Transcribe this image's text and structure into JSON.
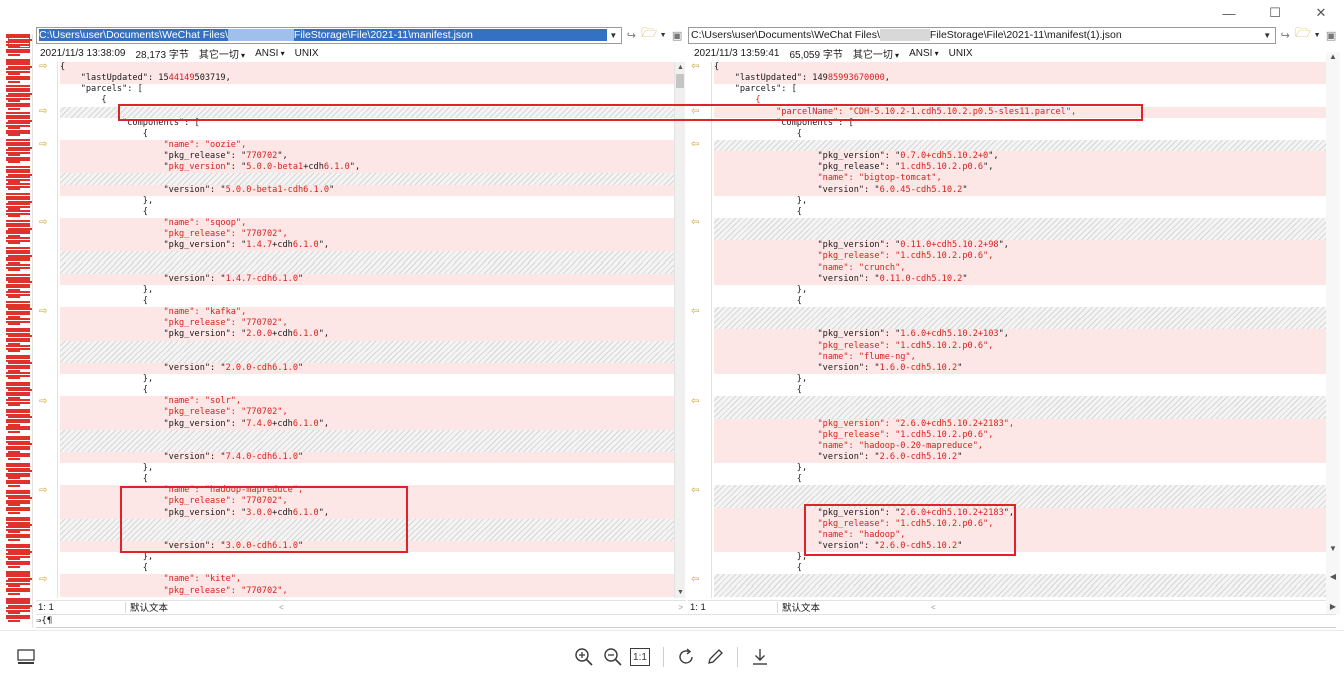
{
  "window": {
    "minimize": "—",
    "maximize": "☐",
    "close": "✕"
  },
  "left": {
    "path_prefix": "C:\\Users\\user\\Documents\\WeChat Files\\",
    "path_suffix": "FileStorage\\File\\2021-11\\manifest.json",
    "timestamp": "2021/11/3 13:38:09",
    "size": "28,173 字节",
    "other": "其它一切",
    "encoding": "ANSI",
    "lineend": "UNIX",
    "status_pos": "1: 1",
    "status_enc": "默认文本"
  },
  "right": {
    "path_prefix": "C:\\Users\\user\\Documents\\WeChat Files\\",
    "path_suffix": "FileStorage\\File\\2021-11\\manifest(1).json",
    "timestamp": "2021/11/3 13:59:41",
    "size": "65,059 字节",
    "other": "其它一切",
    "encoding": "ANSI",
    "lineend": "UNIX",
    "status_pos": "1: 1",
    "status_enc": "默认文本"
  },
  "left_lines": [
    {
      "t": "d",
      "parts": [
        [
          "k",
          "{"
        ]
      ]
    },
    {
      "t": "d",
      "parts": [
        [
          "k",
          "    \"lastUpdated\": 15"
        ],
        [
          "r",
          "44149"
        ],
        [
          "k",
          "503719,"
        ]
      ]
    },
    {
      "t": "n",
      "parts": [
        [
          "k",
          "    \"parcels\": ["
        ]
      ]
    },
    {
      "t": "n",
      "parts": [
        [
          "k",
          "        {"
        ]
      ]
    },
    {
      "t": "h",
      "parts": []
    },
    {
      "t": "n",
      "parts": [
        [
          "k",
          "            \"components\": ["
        ]
      ]
    },
    {
      "t": "n",
      "parts": [
        [
          "k",
          "                {"
        ]
      ]
    },
    {
      "t": "d",
      "parts": [
        [
          "r",
          "                    \"name\": \"oozie\","
        ]
      ]
    },
    {
      "t": "d",
      "parts": [
        [
          "k",
          "                    \"pkg_release\": \""
        ],
        [
          "r",
          "770702"
        ],
        [
          "k",
          "\","
        ]
      ]
    },
    {
      "t": "d",
      "parts": [
        [
          "k",
          "                    \""
        ],
        [
          "r",
          "pkg_version"
        ],
        [
          "k",
          "\": \""
        ],
        [
          "r",
          "5.0.0-beta1"
        ],
        [
          "k",
          "+cdh"
        ],
        [
          "r",
          "6.1.0"
        ],
        [
          "k",
          "\","
        ]
      ]
    },
    {
      "t": "h",
      "parts": []
    },
    {
      "t": "d",
      "parts": [
        [
          "k",
          "                    \"version\": \""
        ],
        [
          "r",
          "5.0.0-beta1-cdh6.1.0"
        ],
        [
          "k",
          "\""
        ]
      ]
    },
    {
      "t": "n",
      "parts": [
        [
          "k",
          "                },"
        ]
      ]
    },
    {
      "t": "n",
      "parts": [
        [
          "k",
          "                {"
        ]
      ]
    },
    {
      "t": "d",
      "parts": [
        [
          "r",
          "                    \"name\": \"sqoop\","
        ]
      ]
    },
    {
      "t": "d",
      "parts": [
        [
          "r",
          "                    \"pkg_release\": \"770702\","
        ]
      ]
    },
    {
      "t": "d",
      "parts": [
        [
          "k",
          "                    \"pkg_version\": \""
        ],
        [
          "r",
          "1.4.7"
        ],
        [
          "k",
          "+cdh"
        ],
        [
          "r",
          "6.1.0"
        ],
        [
          "k",
          "\","
        ]
      ]
    },
    {
      "t": "h",
      "parts": []
    },
    {
      "t": "h",
      "parts": []
    },
    {
      "t": "d",
      "parts": [
        [
          "k",
          "                    \"version\": \""
        ],
        [
          "r",
          "1.4.7-cdh6.1.0"
        ],
        [
          "k",
          "\""
        ]
      ]
    },
    {
      "t": "n",
      "parts": [
        [
          "k",
          "                },"
        ]
      ]
    },
    {
      "t": "n",
      "parts": [
        [
          "k",
          "                {"
        ]
      ]
    },
    {
      "t": "d",
      "parts": [
        [
          "r",
          "                    \"name\": \"kafka\","
        ]
      ]
    },
    {
      "t": "d",
      "parts": [
        [
          "r",
          "                    \"pkg_release\": \"770702\","
        ]
      ]
    },
    {
      "t": "d",
      "parts": [
        [
          "k",
          "                    \"pkg_version\": \""
        ],
        [
          "r",
          "2.0.0"
        ],
        [
          "k",
          "+cdh"
        ],
        [
          "r",
          "6.1.0"
        ],
        [
          "k",
          "\","
        ]
      ]
    },
    {
      "t": "h",
      "parts": []
    },
    {
      "t": "h",
      "parts": []
    },
    {
      "t": "d",
      "parts": [
        [
          "k",
          "                    \"version\": \""
        ],
        [
          "r",
          "2.0.0-cdh6.1.0"
        ],
        [
          "k",
          "\""
        ]
      ]
    },
    {
      "t": "n",
      "parts": [
        [
          "k",
          "                },"
        ]
      ]
    },
    {
      "t": "n",
      "parts": [
        [
          "k",
          "                {"
        ]
      ]
    },
    {
      "t": "d",
      "parts": [
        [
          "r",
          "                    \"name\": \"solr\","
        ]
      ]
    },
    {
      "t": "d",
      "parts": [
        [
          "r",
          "                    \"pkg_release\": \"770702\","
        ]
      ]
    },
    {
      "t": "d",
      "parts": [
        [
          "k",
          "                    \"pkg_version\": \""
        ],
        [
          "r",
          "7.4.0"
        ],
        [
          "k",
          "+cdh"
        ],
        [
          "r",
          "6.1.0"
        ],
        [
          "k",
          "\","
        ]
      ]
    },
    {
      "t": "h",
      "parts": []
    },
    {
      "t": "h",
      "parts": []
    },
    {
      "t": "d",
      "parts": [
        [
          "k",
          "                    \"version\": \""
        ],
        [
          "r",
          "7.4.0-cdh6.1.0"
        ],
        [
          "k",
          "\""
        ]
      ]
    },
    {
      "t": "n",
      "parts": [
        [
          "k",
          "                },"
        ]
      ]
    },
    {
      "t": "n",
      "parts": [
        [
          "k",
          "                {"
        ]
      ]
    },
    {
      "t": "d",
      "parts": [
        [
          "r",
          "                    \"name\": \"hadoop-mapreduce\","
        ]
      ]
    },
    {
      "t": "d",
      "parts": [
        [
          "r",
          "                    \"pkg_release\": \"770702\","
        ]
      ]
    },
    {
      "t": "d",
      "parts": [
        [
          "k",
          "                    \"pkg_version\": \""
        ],
        [
          "r",
          "3.0.0"
        ],
        [
          "k",
          "+cdh"
        ],
        [
          "r",
          "6.1.0"
        ],
        [
          "k",
          "\","
        ]
      ]
    },
    {
      "t": "h",
      "parts": []
    },
    {
      "t": "h",
      "parts": []
    },
    {
      "t": "d",
      "parts": [
        [
          "k",
          "                    \"version\": \""
        ],
        [
          "r",
          "3.0.0-cdh6.1.0"
        ],
        [
          "k",
          "\""
        ]
      ]
    },
    {
      "t": "n",
      "parts": [
        [
          "k",
          "                },"
        ]
      ]
    },
    {
      "t": "n",
      "parts": [
        [
          "k",
          "                {"
        ]
      ]
    },
    {
      "t": "d",
      "parts": [
        [
          "r",
          "                    \"name\": \"kite\","
        ]
      ]
    },
    {
      "t": "d",
      "parts": [
        [
          "r",
          "                    \"pkg_release\": \"770702\","
        ]
      ]
    }
  ],
  "right_lines": [
    {
      "t": "d",
      "parts": [
        [
          "k",
          "{"
        ]
      ]
    },
    {
      "t": "d",
      "parts": [
        [
          "k",
          "    \"lastUpdated\": 149"
        ],
        [
          "r",
          "85993670000"
        ],
        [
          "k",
          ","
        ]
      ]
    },
    {
      "t": "n",
      "parts": [
        [
          "k",
          "    \"parcels\": ["
        ]
      ]
    },
    {
      "t": "n",
      "parts": [
        [
          "r",
          "        {"
        ]
      ]
    },
    {
      "t": "d",
      "parts": [
        [
          "r",
          "            \"parcelName\": \"CDH-5.10.2-1.cdh5.10.2.p0.5-sles11.parcel\","
        ]
      ]
    },
    {
      "t": "n",
      "parts": [
        [
          "k",
          "            \"components\": ["
        ]
      ]
    },
    {
      "t": "n",
      "parts": [
        [
          "k",
          "                {"
        ]
      ]
    },
    {
      "t": "h",
      "parts": []
    },
    {
      "t": "d",
      "parts": [
        [
          "k",
          "                    \"pkg_version\": \""
        ],
        [
          "r",
          "0.7.0+cdh5.10.2+0"
        ],
        [
          "k",
          "\","
        ]
      ]
    },
    {
      "t": "d",
      "parts": [
        [
          "k",
          "                    \"pkg_release\": \""
        ],
        [
          "r",
          "1.cdh5.10.2.p0.6"
        ],
        [
          "k",
          "\","
        ]
      ]
    },
    {
      "t": "d",
      "parts": [
        [
          "r",
          "                    \"name\": \"bigtop-tomcat\","
        ]
      ]
    },
    {
      "t": "d",
      "parts": [
        [
          "k",
          "                    \"version\": \""
        ],
        [
          "r",
          "6.0.45-cdh5.10.2"
        ],
        [
          "k",
          "\""
        ]
      ]
    },
    {
      "t": "n",
      "parts": [
        [
          "k",
          "                },"
        ]
      ]
    },
    {
      "t": "n",
      "parts": [
        [
          "k",
          "                {"
        ]
      ]
    },
    {
      "t": "h",
      "parts": []
    },
    {
      "t": "h",
      "parts": []
    },
    {
      "t": "d",
      "parts": [
        [
          "k",
          "                    \"pkg_version\": \""
        ],
        [
          "r",
          "0.11.0+cdh5.10.2+98"
        ],
        [
          "k",
          "\","
        ]
      ]
    },
    {
      "t": "d",
      "parts": [
        [
          "r",
          "                    \"pkg_release\": \"1.cdh5.10.2.p0.6\","
        ]
      ]
    },
    {
      "t": "d",
      "parts": [
        [
          "r",
          "                    \"name\": \"crunch\","
        ]
      ]
    },
    {
      "t": "d",
      "parts": [
        [
          "k",
          "                    \"version\": \""
        ],
        [
          "r",
          "0.11.0-cdh5.10.2"
        ],
        [
          "k",
          "\""
        ]
      ]
    },
    {
      "t": "n",
      "parts": [
        [
          "k",
          "                },"
        ]
      ]
    },
    {
      "t": "n",
      "parts": [
        [
          "k",
          "                {"
        ]
      ]
    },
    {
      "t": "h",
      "parts": []
    },
    {
      "t": "h",
      "parts": []
    },
    {
      "t": "d",
      "parts": [
        [
          "k",
          "                    \"pkg_version\": \""
        ],
        [
          "r",
          "1.6.0+cdh5.10.2+103"
        ],
        [
          "k",
          "\","
        ]
      ]
    },
    {
      "t": "d",
      "parts": [
        [
          "r",
          "                    \"pkg_release\": \"1.cdh5.10.2.p0.6\","
        ]
      ]
    },
    {
      "t": "d",
      "parts": [
        [
          "r",
          "                    \"name\": \"flume-ng\","
        ]
      ]
    },
    {
      "t": "d",
      "parts": [
        [
          "k",
          "                    \"version\": \""
        ],
        [
          "r",
          "1.6.0-cdh5.10.2"
        ],
        [
          "k",
          "\""
        ]
      ]
    },
    {
      "t": "n",
      "parts": [
        [
          "k",
          "                },"
        ]
      ]
    },
    {
      "t": "n",
      "parts": [
        [
          "k",
          "                {"
        ]
      ]
    },
    {
      "t": "h",
      "parts": []
    },
    {
      "t": "h",
      "parts": []
    },
    {
      "t": "d",
      "parts": [
        [
          "r",
          "                    \"pkg_version\": \"2.6.0+cdh5.10.2+2183\","
        ]
      ]
    },
    {
      "t": "d",
      "parts": [
        [
          "r",
          "                    \"pkg_release\": \"1.cdh5.10.2.p0.6\","
        ]
      ]
    },
    {
      "t": "d",
      "parts": [
        [
          "r",
          "                    \"name\": \"hadoop-0.20-mapreduce\","
        ]
      ]
    },
    {
      "t": "d",
      "parts": [
        [
          "k",
          "                    \"version\": \""
        ],
        [
          "r",
          "2.6.0-cdh5.10.2"
        ],
        [
          "k",
          "\""
        ]
      ]
    },
    {
      "t": "n",
      "parts": [
        [
          "k",
          "                },"
        ]
      ]
    },
    {
      "t": "n",
      "parts": [
        [
          "k",
          "                {"
        ]
      ]
    },
    {
      "t": "h",
      "parts": []
    },
    {
      "t": "h",
      "parts": []
    },
    {
      "t": "d",
      "parts": [
        [
          "k",
          "                    \"pkg_version\": \""
        ],
        [
          "r",
          "2.6.0+cdh5.10.2+2183"
        ],
        [
          "k",
          "\","
        ]
      ]
    },
    {
      "t": "d",
      "parts": [
        [
          "r",
          "                    \"pkg_release\": \"1.cdh5.10.2.p0.6\","
        ]
      ]
    },
    {
      "t": "d",
      "parts": [
        [
          "r",
          "                    \"name\": \"hadoop\","
        ]
      ]
    },
    {
      "t": "d",
      "parts": [
        [
          "k",
          "                    \"version\": \""
        ],
        [
          "r",
          "2.6.0-cdh5.10.2"
        ],
        [
          "k",
          "\""
        ]
      ]
    },
    {
      "t": "n",
      "parts": [
        [
          "k",
          "                },"
        ]
      ]
    },
    {
      "t": "n",
      "parts": [
        [
          "k",
          "                {"
        ]
      ]
    },
    {
      "t": "h",
      "parts": []
    },
    {
      "t": "h",
      "parts": []
    }
  ],
  "bottom_line_text": "⇒{¶",
  "accent_red": "#e0222a",
  "diff_bg": "#fde6e6",
  "viewer_toolbar": {
    "zoom_in": "zoom-in-icon",
    "zoom_out": "zoom-out-icon",
    "actual_size": "1:1",
    "rotate": "rotate-icon",
    "edit": "edit-icon",
    "download": "download-icon"
  }
}
